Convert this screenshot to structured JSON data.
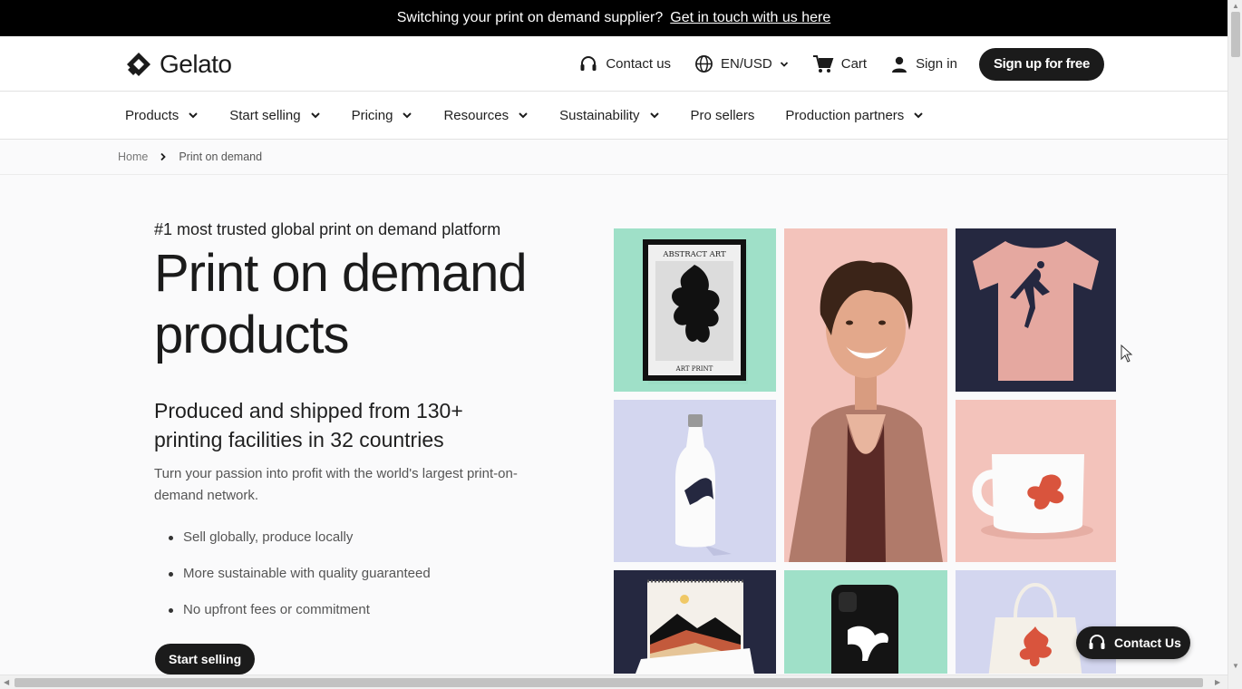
{
  "banner": {
    "text": "Switching your print on demand supplier?",
    "link": "Get in touch with us here"
  },
  "header": {
    "logo_text": "Gelato",
    "contact_label": "Contact us",
    "locale_label": "EN/USD",
    "cart_label": "Cart",
    "signin_label": "Sign in",
    "signup_label": "Sign up for free"
  },
  "nav": {
    "items": [
      {
        "label": "Products"
      },
      {
        "label": "Start selling"
      },
      {
        "label": "Pricing"
      },
      {
        "label": "Resources"
      },
      {
        "label": "Sustainability"
      },
      {
        "label": "Pro sellers"
      },
      {
        "label": "Production partners"
      }
    ]
  },
  "breadcrumb": {
    "home": "Home",
    "current": "Print on demand"
  },
  "hero": {
    "eyebrow": "#1 most trusted global print on demand platform",
    "title_line1": "Print on demand",
    "title_line2": "products",
    "subhead_line1": "Produced and shipped from 130+",
    "subhead_line2": "printing facilities in 32 countries",
    "lead": "Turn your passion into profit with the world's largest print-on-demand network.",
    "bullets": [
      "Sell globally, produce locally",
      "More sustainable with quality guaranteed",
      "No upfront fees or commitment"
    ],
    "cta_label": "Start selling"
  },
  "gallery": {
    "poster_top": "ABSTRACT ART",
    "poster_bottom": "ART PRINT"
  },
  "floating": {
    "contact_label": "Contact Us"
  },
  "colors": {
    "mint": "#9fe0c8",
    "navy": "#252840",
    "lavender": "#d3d6ef",
    "pink": "#f3c3bb",
    "black": "#1b1b1b"
  }
}
